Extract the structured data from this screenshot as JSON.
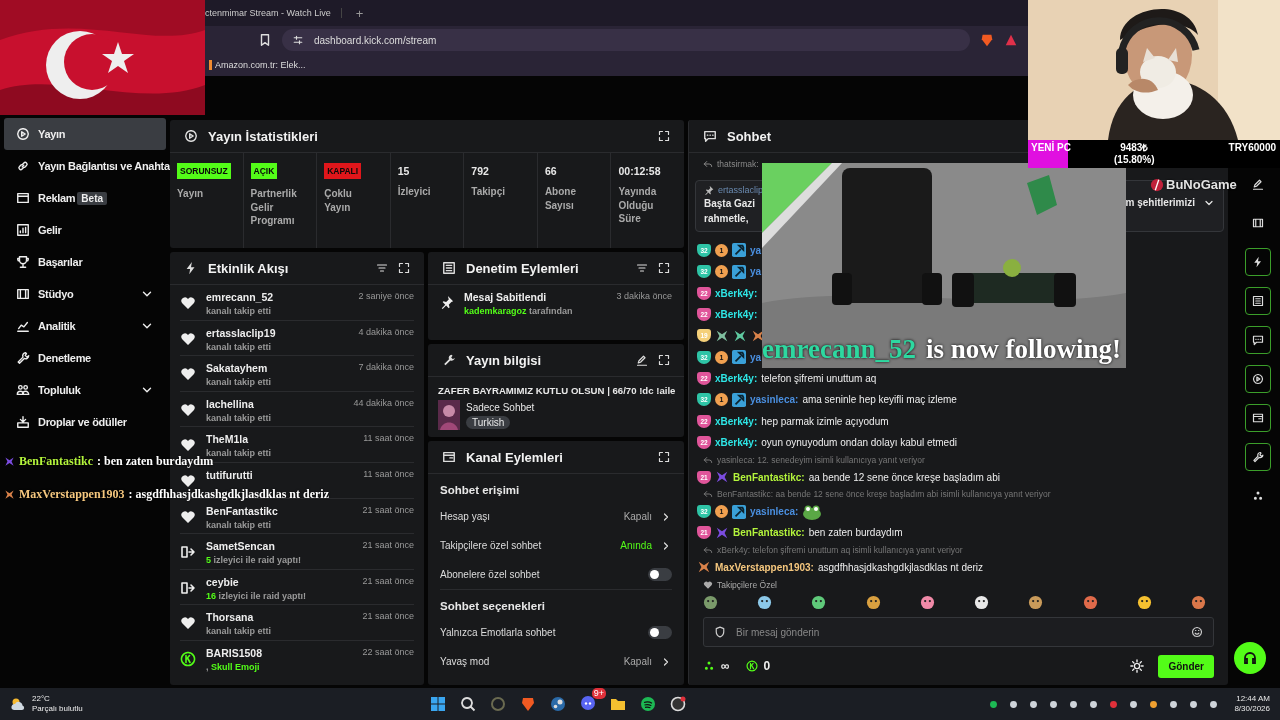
{
  "browser": {
    "tab_title": "ctenmimar Stream - Watch Live",
    "new_tab": "+",
    "url": "dashboard.kick.com/stream",
    "bookmarks": [
      "Amazon.com.tr: Elek..."
    ]
  },
  "goal": {
    "title": "YENİ PC",
    "amount": "9483₺",
    "percent": "(15.80%)",
    "target": "TRY60000",
    "level": 0.158
  },
  "sidebar": {
    "items": [
      {
        "label": "Yayın",
        "selected": true,
        "expandable": false
      },
      {
        "label": "Yayın Bağlantısı ve Anahta",
        "selected": false,
        "expandable": false
      },
      {
        "label": "Reklam",
        "badge": "Beta",
        "selected": false,
        "expandable": false
      },
      {
        "label": "Gelir",
        "selected": false,
        "expandable": false
      },
      {
        "label": "Başarılar",
        "selected": false,
        "expandable": false
      },
      {
        "label": "Stüdyo",
        "selected": false,
        "expandable": true
      },
      {
        "label": "Analitik",
        "selected": false,
        "expandable": true
      },
      {
        "label": "Denetleme",
        "selected": false,
        "expandable": false
      },
      {
        "label": "Topluluk",
        "selected": false,
        "expandable": true
      },
      {
        "label": "Droplar ve ödüller",
        "selected": false,
        "expandable": false
      }
    ]
  },
  "overlay_chat": [
    {
      "name": "BenFantastikc",
      "text": ": ben zaten burdaydım",
      "color": "#b4f53c"
    },
    {
      "name": "MaxVerstappen1903",
      "text": ": asgdfhhasjdkashgdkjlasdklas nt deriz",
      "color": "#f5c77e"
    }
  ],
  "stream_stats": {
    "title": "Yayın İstatistikleri",
    "cells": [
      {
        "kind": "badge",
        "value": "SORUNSUZ",
        "color": "#53fc18",
        "label": "Yayın"
      },
      {
        "kind": "badge",
        "value": "AÇIK",
        "color": "#53fc18",
        "label": "Partnerlik Gelir Programı"
      },
      {
        "kind": "badge",
        "value": "KAPALI",
        "color": "#e0161b",
        "label": "Çoklu Yayın"
      },
      {
        "kind": "number",
        "value": "15",
        "label": "İzleyici"
      },
      {
        "kind": "number",
        "value": "792",
        "label": "Takipçi"
      },
      {
        "kind": "number",
        "value": "66",
        "label": "Abone Sayısı"
      },
      {
        "kind": "number",
        "value": "00:12:58",
        "label": "Yayında Olduğu Süre"
      }
    ]
  },
  "activity": {
    "title": "Etkinlik Akışı",
    "items": [
      {
        "kind": "follow",
        "name": "emrecann_52",
        "detail": "kanalı takip etti",
        "time": "2 saniye önce"
      },
      {
        "kind": "follow",
        "name": "ertasslaclip19",
        "detail": "kanalı takip etti",
        "time": "4 dakika önce"
      },
      {
        "kind": "follow",
        "name": "Sakatayhem",
        "detail": "kanalı takip etti",
        "time": "7 dakika önce"
      },
      {
        "kind": "follow",
        "name": "lachellina",
        "detail": "kanalı takip etti",
        "time": "44 dakika önce"
      },
      {
        "kind": "follow",
        "name": "TheM1la",
        "detail": "kanalı takip etti",
        "time": "11 saat önce"
      },
      {
        "kind": "follow",
        "name": "tutifurutti",
        "time": "11 saat önce"
      },
      {
        "kind": "follow",
        "name": "BenFantastikc",
        "detail": "kanalı takip etti",
        "time": "21 saat önce"
      },
      {
        "kind": "raid",
        "name": "SametSencan",
        "highlight": "5",
        "detail": "izleyici ile raid yaptı!",
        "time": "21 saat önce"
      },
      {
        "kind": "raid",
        "name": "ceybie",
        "highlight": "16",
        "detail": "izleyici ile raid yaptı!",
        "time": "21 saat önce"
      },
      {
        "kind": "follow",
        "name": "Thorsana",
        "detail": "kanalı takip etti",
        "time": "21 saat önce"
      },
      {
        "kind": "emote",
        "name": "BARIS1508",
        "detail": ",",
        "highlight": "Skull Emoji",
        "time": "22 saat önce"
      }
    ]
  },
  "moderation": {
    "title": "Denetim Eylemleri",
    "items": [
      {
        "title": "Mesaj Sabitlendi",
        "actor": "kademkaragoz",
        "suffix": "tarafından",
        "time": "3 dakika önce"
      }
    ]
  },
  "stream_info": {
    "title": "Yayın bilgisi",
    "stream_title": "ZAFER BAYRAMIMIZ KUTLU OLSUN | 66/70 !dc !aile",
    "category": "Sadece Sohbet",
    "tags": [
      "Turkish"
    ]
  },
  "channel_actions": {
    "title": "Kanal Eylemleri",
    "sections": [
      {
        "heading": "Sohbet erişimi",
        "rows": [
          {
            "kind": "link",
            "label": "Hesap yaşı",
            "value": "Kapalı",
            "active": false
          },
          {
            "kind": "link",
            "label": "Takipçilere özel sohbet",
            "value": "Anında",
            "active": true
          },
          {
            "kind": "toggle",
            "label": "Abonelere özel sohbet",
            "on": false
          }
        ]
      },
      {
        "heading": "Sohbet seçenekleri",
        "rows": [
          {
            "kind": "toggle",
            "label": "Yalnızca Emotlarla sohbet",
            "on": false
          },
          {
            "kind": "link",
            "label": "Yavaş mod",
            "value": "Kapalı",
            "active": false
          }
        ]
      }
    ]
  },
  "chat": {
    "title": "Sohbet",
    "top_reply": "thatsirmak:",
    "pinned": {
      "author": "ertasslaclip",
      "lines": [
        "Başta Gazi",
        "rahmetle,"
      ],
      "tail": "m şehitlerimizi"
    },
    "messages": [
      {
        "badges": [
          {
            "kind": "sub",
            "text": "32",
            "color": "#2ec4a6"
          },
          {
            "kind": "gift",
            "text": "1",
            "color": "#f0a050"
          },
          {
            "kind": "mod",
            "color": "#3aa0d8"
          }
        ],
        "name": "ya",
        "color": "#4a8fe0"
      },
      {
        "badges": [
          {
            "kind": "sub",
            "text": "32",
            "color": "#2ec4a6"
          },
          {
            "kind": "gift",
            "text": "1",
            "color": "#f0a050"
          },
          {
            "kind": "mod",
            "color": "#3aa0d8"
          }
        ],
        "name": "ya",
        "color": "#4a8fe0"
      },
      {
        "badges": [
          {
            "kind": "sub",
            "text": "22",
            "color": "#e0559a"
          }
        ],
        "name": "xBerk4y:",
        "color": "#2ee6e6"
      },
      {
        "badges": [
          {
            "kind": "sub",
            "text": "22",
            "color": "#e0559a"
          }
        ],
        "name": "xBerk4y:",
        "color": "#2ee6e6"
      },
      {
        "badges": [
          {
            "kind": "sub",
            "text": "19",
            "color": "#f5d07a"
          },
          {
            "kind": "emblem",
            "color": "#7fbf9f"
          },
          {
            "kind": "emblem",
            "color": "#5fc9a0"
          },
          {
            "kind": "emblem",
            "color": "#d9824a"
          }
        ]
      },
      {
        "badges": [
          {
            "kind": "sub",
            "text": "32",
            "color": "#2ec4a6"
          },
          {
            "kind": "gift",
            "text": "1",
            "color": "#f0a050"
          },
          {
            "kind": "mod",
            "color": "#3aa0d8"
          }
        ],
        "name": "ya",
        "color": "#4a8fe0"
      },
      {
        "badges": [
          {
            "kind": "sub",
            "text": "22",
            "color": "#e0559a"
          }
        ],
        "name": "xBerk4y:",
        "color": "#2ee6e6",
        "text": "telefon şifremi unuttum aq"
      },
      {
        "badges": [
          {
            "kind": "sub",
            "text": "32",
            "color": "#2ec4a6"
          },
          {
            "kind": "gift",
            "text": "1",
            "color": "#f0a050"
          },
          {
            "kind": "mod",
            "color": "#3aa0d8"
          }
        ],
        "name": "yasinleca:",
        "color": "#4a8fe0",
        "text": "ama seninle hep keyifli maç izleme"
      },
      {
        "badges": [
          {
            "kind": "sub",
            "text": "22",
            "color": "#e0559a"
          }
        ],
        "name": "xBerk4y:",
        "color": "#2ee6e6",
        "text": "hep parmak izimle açıyodum"
      },
      {
        "badges": [
          {
            "kind": "sub",
            "text": "22",
            "color": "#e0559a"
          }
        ],
        "name": "xBerk4y:",
        "color": "#2ee6e6",
        "text": "oyun oynuyodum ondan dolayı kabul etmedi"
      },
      {
        "reply": "yasinleca: 12. senedeyim isimli kullanıcıya yanıt veriyor",
        "badges": [
          {
            "kind": "sub",
            "text": "21",
            "color": "#e0559a"
          },
          {
            "kind": "emblem",
            "color": "#7b4ce0"
          }
        ],
        "name": "BenFantastikc:",
        "color": "#b4f53c",
        "text": "aa bende 12 sene önce kreşe başladım abi"
      },
      {
        "reply": "BenFantastikc: aa bende 12 sene önce kreşe başladım abi isimli kullanıcıya yanıt veriyor",
        "badges": [
          {
            "kind": "sub",
            "text": "32",
            "color": "#2ec4a6"
          },
          {
            "kind": "gift",
            "text": "1",
            "color": "#f0a050"
          },
          {
            "kind": "mod",
            "color": "#3aa0d8"
          }
        ],
        "name": "yasinleca:",
        "color": "#4a8fe0",
        "emote": true
      },
      {
        "badges": [
          {
            "kind": "sub",
            "text": "21",
            "color": "#e0559a"
          },
          {
            "kind": "emblem",
            "color": "#7b4ce0"
          }
        ],
        "name": "BenFantastikc:",
        "color": "#b4f53c",
        "text": "ben zaten burdaydım"
      },
      {
        "reply": "xBerk4y: telefon şifremi unuttum aq isimli kullanıcıya yanıt veriyor",
        "badges": [
          {
            "kind": "emblem",
            "color": "#d9824a"
          }
        ],
        "name": "MaxVerstappen1903:",
        "color": "#f5c77e",
        "text": "asgdfhhasjdkashgdkjlasdklas nt deriz"
      }
    ],
    "followers_only": "Takipçilere Özel",
    "placeholder": "Bir mesaj gönderin",
    "points": "∞",
    "kicks": "0",
    "send": "Gönder"
  },
  "follow_alert": {
    "follower": "emrecann_52",
    "message": "is now following!"
  },
  "logo_overlay": "BuNoGame",
  "rail": [
    {
      "selected": false
    },
    {
      "selected": false
    },
    {
      "selected": true
    },
    {
      "selected": true
    },
    {
      "selected": true
    },
    {
      "selected": true
    },
    {
      "selected": true
    },
    {
      "selected": true
    },
    {
      "selected": false
    }
  ],
  "taskbar": {
    "temperature": "22°C",
    "weather": "Parçalı bulutlu",
    "notification": "9+",
    "time": "12:44 AM",
    "date": "8/30/2026"
  }
}
